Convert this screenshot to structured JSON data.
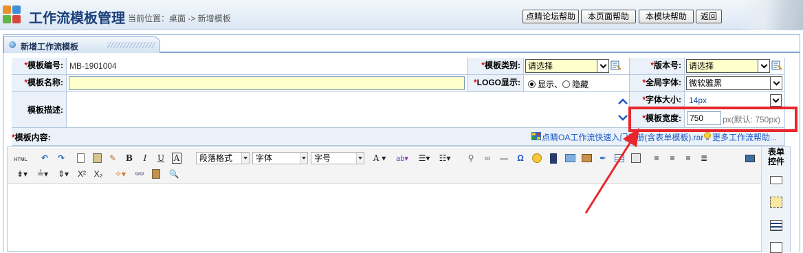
{
  "header": {
    "title": "工作流模板管理",
    "breadcrumb": "当前位置：桌面 -> 新增模板",
    "buttons": [
      "点睛论坛帮助",
      "本页面帮助",
      "本模块帮助",
      "返回"
    ]
  },
  "panel": {
    "title": "新增工作流模板"
  },
  "form": {
    "template_no_label": "模板编号:",
    "template_no_value": "MB-1901004",
    "category_label": "模板类别:",
    "category_value": "请选择",
    "version_label": "版本号:",
    "version_value": "请选择",
    "name_label": "模板名称:",
    "name_value": "",
    "logo_label": "LOGO显示:",
    "logo_show": "显示",
    "logo_sep": "、",
    "logo_hide": "隐藏",
    "global_font_label": "全局字体:",
    "global_font_value": "微软雅黑",
    "desc_label": "模板描述:",
    "font_size_label": "字体大小:",
    "font_size_value": "14px",
    "width_label": "模板宽度:",
    "width_value": "750",
    "width_hint": "px(默认: 750px)",
    "content_label": "模板内容:",
    "download_link": "点睛OA工作流快速入门手册(含表单模板).rar",
    "more_help_link": "更多工作流帮助..."
  },
  "editor": {
    "html_label": "HTML",
    "paragraph_format": "段落格式",
    "font": "字体",
    "font_size": "字号",
    "side_title": "表单控件"
  },
  "colors": {
    "accent": "#1a3f7a",
    "highlight": "#e8262c",
    "required": "#dd0000"
  }
}
